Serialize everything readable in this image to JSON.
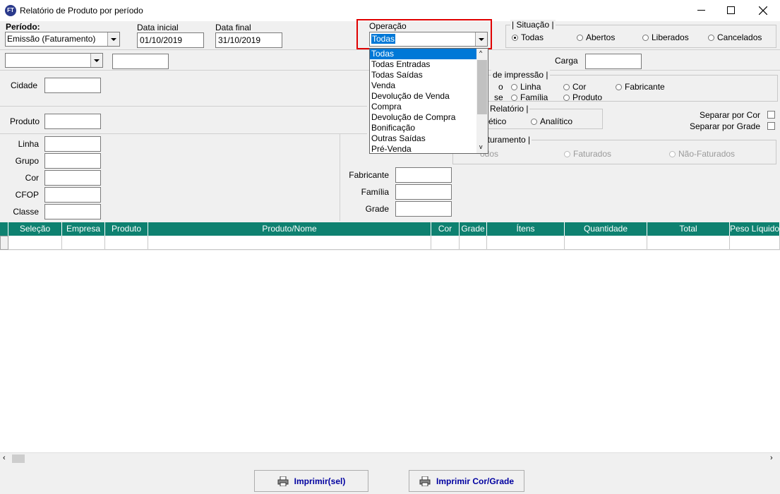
{
  "window": {
    "title": "Relatório de Produto por período",
    "app_icon_text": "FT"
  },
  "header": {
    "periodo_label": "Período:",
    "periodo_value": "Emissão (Faturamento)",
    "data_inicial_label": "Data inicial",
    "data_inicial_value": "01/10/2019",
    "data_final_label": "Data final",
    "data_final_value": "31/10/2019",
    "operacao_label": "Operação",
    "operacao_value": "Todas"
  },
  "situacao": {
    "legend": "Situação",
    "options": [
      "Todas",
      "Abertos",
      "Liberados",
      "Cancelados"
    ],
    "selected": "Todas"
  },
  "carga": {
    "label": "Carga",
    "value": ""
  },
  "filters": {
    "cidade": "Cidade",
    "produto": "Produto",
    "linha": "Linha",
    "grupo": "Grupo",
    "cor": "Cor",
    "cfop": "CFOP",
    "classe": "Classe",
    "fabricante": "Fabricante",
    "familia": "Família",
    "grade": "Grade"
  },
  "impressao": {
    "legend_partial": "de impressão",
    "options": [
      "o",
      "se",
      "Linha",
      "Família",
      "Cor",
      "Produto",
      "Fabricante"
    ]
  },
  "relatorio": {
    "legend_partial": "e Relatório",
    "options": [
      "ético",
      "Analítico"
    ]
  },
  "separar": {
    "por_cor": "Separar por Cor",
    "por_grade": "Separar por Grade"
  },
  "faturamento": {
    "legend_partial": "aturamento",
    "options": [
      "odos",
      "Faturados",
      "Não-Faturados"
    ]
  },
  "operacao_dropdown": {
    "items": [
      "Todas",
      "Todas Entradas",
      "Todas Saídas",
      "Venda",
      "Devolução de Venda",
      "Compra",
      "Devolução de Compra",
      "Bonificação",
      "Outras Saídas",
      "Pré-Venda"
    ],
    "selected_index": 0
  },
  "grid": {
    "columns": [
      "Seleção",
      "Empresa",
      "Produto",
      "Produto/Nome",
      "Cor",
      "Grade",
      "Ítens",
      "Quantidade",
      "Total",
      "Peso Líquido"
    ]
  },
  "buttons": {
    "imprimir_sel": "Imprimir(sel)",
    "imprimir_cor_grade": "Imprimir Cor/Grade"
  },
  "colors": {
    "grid_header": "#0e8170",
    "highlight_box": "#e00000",
    "selection": "#0078d7",
    "button_text": "#0000a0"
  }
}
